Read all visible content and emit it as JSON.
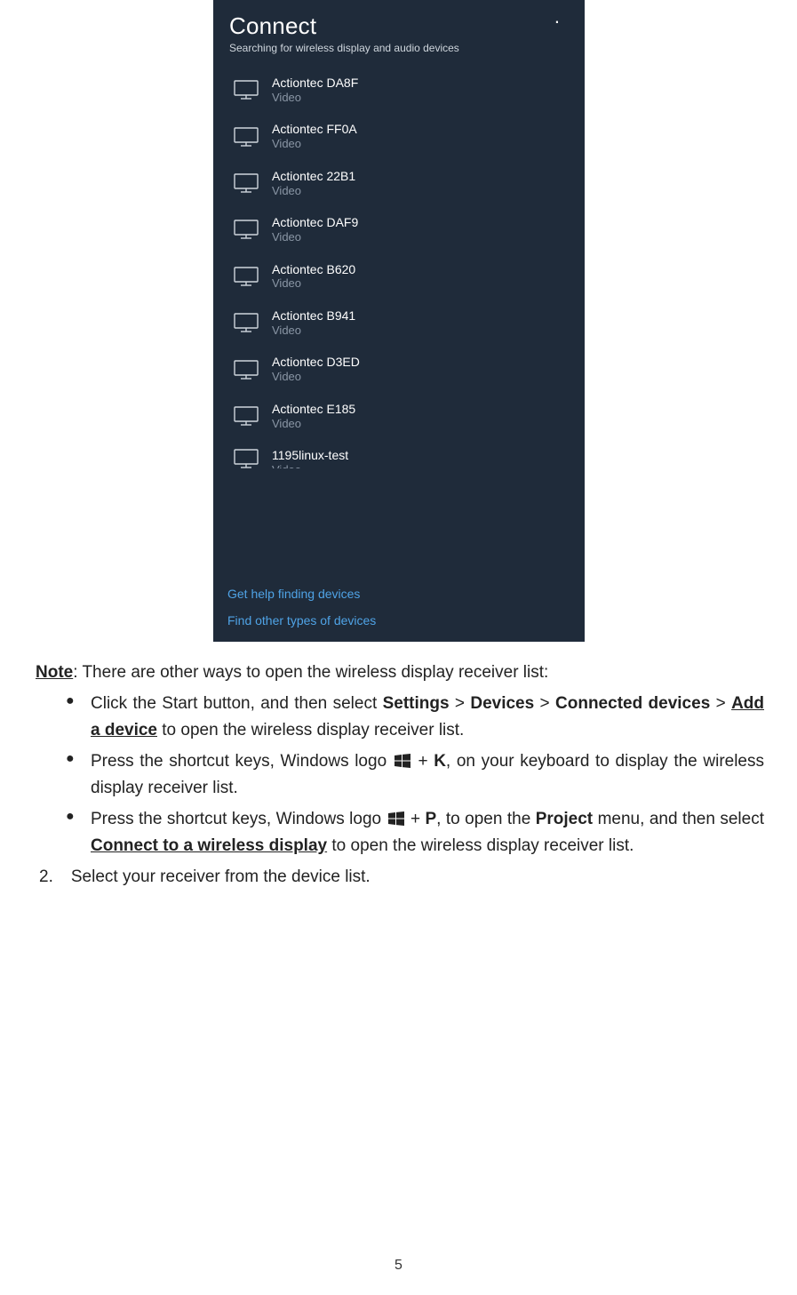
{
  "panel": {
    "title": "Connect",
    "subtitle": "Searching for wireless display and audio devices",
    "indicator": ".",
    "devices": [
      {
        "name": "Actiontec DA8F",
        "type": "Video"
      },
      {
        "name": "Actiontec FF0A",
        "type": "Video"
      },
      {
        "name": "Actiontec 22B1",
        "type": "Video"
      },
      {
        "name": "Actiontec DAF9",
        "type": "Video"
      },
      {
        "name": "Actiontec B620",
        "type": "Video"
      },
      {
        "name": "Actiontec B941",
        "type": "Video"
      },
      {
        "name": "Actiontec D3ED",
        "type": "Video"
      },
      {
        "name": "Actiontec E185",
        "type": "Video"
      },
      {
        "name": "1195linux-test",
        "type": "Video"
      }
    ],
    "links": {
      "help": "Get help finding devices",
      "other": "Find other types of devices"
    }
  },
  "doc": {
    "note_label": "Note",
    "note_rest": ": There are other ways to open the wireless display receiver list:",
    "b1": {
      "t1": "Click the Start button, and then select ",
      "settings": "Settings",
      "gt1": " > ",
      "devices": "Devices",
      "gt2": " > ",
      "cd": "Connected devices",
      "gt3": " > ",
      "add": "Add a device",
      "t2": " to open the wireless display receiver list."
    },
    "b2": {
      "t1": "Press the shortcut keys, Windows logo ",
      "plus": " + ",
      "key": "K",
      "t2": ", on your keyboard to display the wireless display receiver list."
    },
    "b3": {
      "t1": "Press the shortcut keys, Windows logo ",
      "plus": " + ",
      "key": "P",
      "t2": ", to open the ",
      "project": "Project",
      "t3": " menu, and then select ",
      "cwd": "Connect to a wireless display",
      "t4": " to open the wireless display receiver list."
    },
    "step2_n": "2.",
    "step2_t": "Select your receiver from the device list.",
    "page_number": "5"
  }
}
